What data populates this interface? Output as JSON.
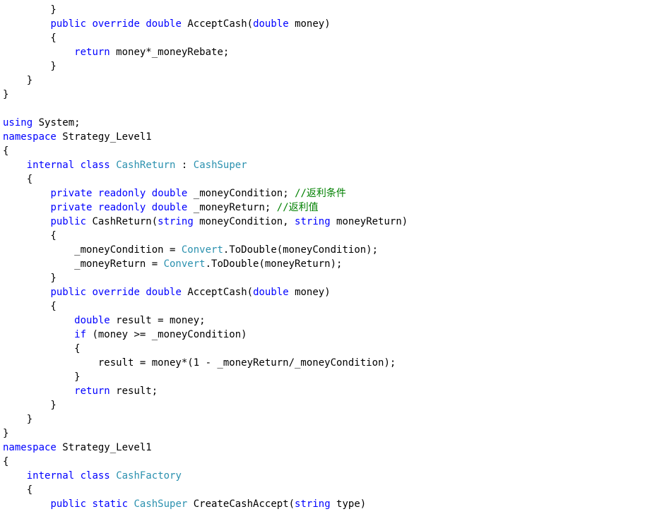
{
  "editor": {
    "language": "C#",
    "colors": {
      "background": "#ffffff",
      "keyword": "#0000ff",
      "type": "#2b91af",
      "comment": "#008000",
      "plain": "#000000"
    },
    "lines": [
      [
        {
          "t": "        }",
          "k": "plain"
        }
      ],
      [
        {
          "t": "        ",
          "k": "plain"
        },
        {
          "t": "public",
          "k": "kw"
        },
        {
          "t": " ",
          "k": "plain"
        },
        {
          "t": "override",
          "k": "kw"
        },
        {
          "t": " ",
          "k": "plain"
        },
        {
          "t": "double",
          "k": "kw"
        },
        {
          "t": " AcceptCash(",
          "k": "plain"
        },
        {
          "t": "double",
          "k": "kw"
        },
        {
          "t": " money)",
          "k": "plain"
        }
      ],
      [
        {
          "t": "        {",
          "k": "plain"
        }
      ],
      [
        {
          "t": "            ",
          "k": "plain"
        },
        {
          "t": "return",
          "k": "kw"
        },
        {
          "t": " money*_moneyRebate;",
          "k": "plain"
        }
      ],
      [
        {
          "t": "        }",
          "k": "plain"
        }
      ],
      [
        {
          "t": "    }",
          "k": "plain"
        }
      ],
      [
        {
          "t": "}",
          "k": "plain"
        }
      ],
      [
        {
          "t": "",
          "k": "plain"
        }
      ],
      [
        {
          "t": "using",
          "k": "kw"
        },
        {
          "t": " System;",
          "k": "plain"
        }
      ],
      [
        {
          "t": "namespace",
          "k": "kw"
        },
        {
          "t": " Strategy_Level1",
          "k": "plain"
        }
      ],
      [
        {
          "t": "{",
          "k": "plain"
        }
      ],
      [
        {
          "t": "    ",
          "k": "plain"
        },
        {
          "t": "internal",
          "k": "kw"
        },
        {
          "t": " ",
          "k": "plain"
        },
        {
          "t": "class",
          "k": "kw"
        },
        {
          "t": " ",
          "k": "plain"
        },
        {
          "t": "CashReturn",
          "k": "type"
        },
        {
          "t": " : ",
          "k": "plain"
        },
        {
          "t": "CashSuper",
          "k": "type"
        }
      ],
      [
        {
          "t": "    {",
          "k": "plain"
        }
      ],
      [
        {
          "t": "        ",
          "k": "plain"
        },
        {
          "t": "private",
          "k": "kw"
        },
        {
          "t": " ",
          "k": "plain"
        },
        {
          "t": "readonly",
          "k": "kw"
        },
        {
          "t": " ",
          "k": "plain"
        },
        {
          "t": "double",
          "k": "kw"
        },
        {
          "t": " _moneyCondition; ",
          "k": "plain"
        },
        {
          "t": "//返利条件",
          "k": "comment"
        }
      ],
      [
        {
          "t": "        ",
          "k": "plain"
        },
        {
          "t": "private",
          "k": "kw"
        },
        {
          "t": " ",
          "k": "plain"
        },
        {
          "t": "readonly",
          "k": "kw"
        },
        {
          "t": " ",
          "k": "plain"
        },
        {
          "t": "double",
          "k": "kw"
        },
        {
          "t": " _moneyReturn; ",
          "k": "plain"
        },
        {
          "t": "//返利值",
          "k": "comment"
        }
      ],
      [
        {
          "t": "        ",
          "k": "plain"
        },
        {
          "t": "public",
          "k": "kw"
        },
        {
          "t": " CashReturn(",
          "k": "plain"
        },
        {
          "t": "string",
          "k": "kw"
        },
        {
          "t": " moneyCondition, ",
          "k": "plain"
        },
        {
          "t": "string",
          "k": "kw"
        },
        {
          "t": " moneyReturn)",
          "k": "plain"
        }
      ],
      [
        {
          "t": "        {",
          "k": "plain"
        }
      ],
      [
        {
          "t": "            _moneyCondition = ",
          "k": "plain"
        },
        {
          "t": "Convert",
          "k": "type"
        },
        {
          "t": ".ToDouble(moneyCondition);",
          "k": "plain"
        }
      ],
      [
        {
          "t": "            _moneyReturn = ",
          "k": "plain"
        },
        {
          "t": "Convert",
          "k": "type"
        },
        {
          "t": ".ToDouble(moneyReturn);",
          "k": "plain"
        }
      ],
      [
        {
          "t": "        }",
          "k": "plain"
        }
      ],
      [
        {
          "t": "        ",
          "k": "plain"
        },
        {
          "t": "public",
          "k": "kw"
        },
        {
          "t": " ",
          "k": "plain"
        },
        {
          "t": "override",
          "k": "kw"
        },
        {
          "t": " ",
          "k": "plain"
        },
        {
          "t": "double",
          "k": "kw"
        },
        {
          "t": " AcceptCash(",
          "k": "plain"
        },
        {
          "t": "double",
          "k": "kw"
        },
        {
          "t": " money)",
          "k": "plain"
        }
      ],
      [
        {
          "t": "        {",
          "k": "plain"
        }
      ],
      [
        {
          "t": "            ",
          "k": "plain"
        },
        {
          "t": "double",
          "k": "kw"
        },
        {
          "t": " result = money;",
          "k": "plain"
        }
      ],
      [
        {
          "t": "            ",
          "k": "plain"
        },
        {
          "t": "if",
          "k": "kw"
        },
        {
          "t": " (money >= _moneyCondition)",
          "k": "plain"
        }
      ],
      [
        {
          "t": "            {",
          "k": "plain"
        }
      ],
      [
        {
          "t": "                result = money*(1 - _moneyReturn/_moneyCondition);",
          "k": "plain"
        }
      ],
      [
        {
          "t": "            }",
          "k": "plain"
        }
      ],
      [
        {
          "t": "            ",
          "k": "plain"
        },
        {
          "t": "return",
          "k": "kw"
        },
        {
          "t": " result;",
          "k": "plain"
        }
      ],
      [
        {
          "t": "        }",
          "k": "plain"
        }
      ],
      [
        {
          "t": "    }",
          "k": "plain"
        }
      ],
      [
        {
          "t": "}",
          "k": "plain"
        }
      ],
      [
        {
          "t": "namespace",
          "k": "kw"
        },
        {
          "t": " Strategy_Level1",
          "k": "plain"
        }
      ],
      [
        {
          "t": "{",
          "k": "plain"
        }
      ],
      [
        {
          "t": "    ",
          "k": "plain"
        },
        {
          "t": "internal",
          "k": "kw"
        },
        {
          "t": " ",
          "k": "plain"
        },
        {
          "t": "class",
          "k": "kw"
        },
        {
          "t": " ",
          "k": "plain"
        },
        {
          "t": "CashFactory",
          "k": "type"
        }
      ],
      [
        {
          "t": "    {",
          "k": "plain"
        }
      ],
      [
        {
          "t": "        ",
          "k": "plain"
        },
        {
          "t": "public",
          "k": "kw"
        },
        {
          "t": " ",
          "k": "plain"
        },
        {
          "t": "static",
          "k": "kw"
        },
        {
          "t": " ",
          "k": "plain"
        },
        {
          "t": "CashSuper",
          "k": "type"
        },
        {
          "t": " CreateCashAccept(",
          "k": "plain"
        },
        {
          "t": "string",
          "k": "kw"
        },
        {
          "t": " type)",
          "k": "plain"
        }
      ]
    ]
  }
}
